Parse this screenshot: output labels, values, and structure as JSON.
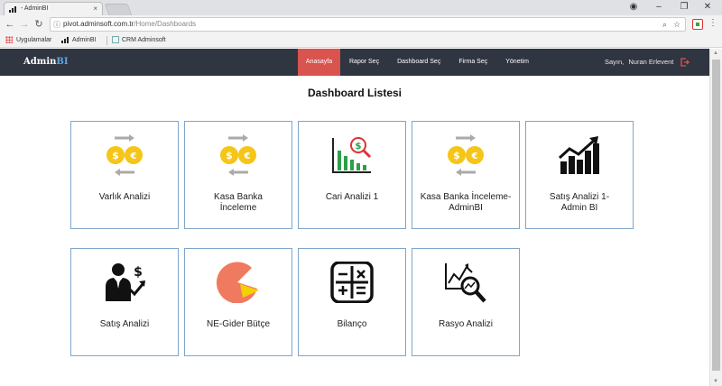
{
  "browser": {
    "tab_title": "- AdminBI",
    "url_host": "pivot.adminsoft.com.tr",
    "url_path": "/Home/Dashboards"
  },
  "bookmarks": [
    {
      "label": "Uygulamalar"
    },
    {
      "label": "AdminBI"
    },
    {
      "label": "CRM Adminsoft"
    }
  ],
  "app": {
    "brand_main": "Admin",
    "brand_accent": "BI",
    "nav": [
      {
        "label": "Anasayfa",
        "active": true
      },
      {
        "label": "Rapor Seç"
      },
      {
        "label": "Dashboard Seç"
      },
      {
        "label": "Firma Seç"
      },
      {
        "label": "Yönetim"
      }
    ],
    "user_greeting": "Sayın,",
    "user_name": "Nuran Erlevent"
  },
  "page": {
    "title": "Dashboard Listesi",
    "cards": [
      {
        "label": "Varlık Analizi",
        "icon": "currency-exchange-icon"
      },
      {
        "label": "Kasa Banka İnceleme",
        "icon": "currency-exchange-icon"
      },
      {
        "label": "Cari Analizi 1",
        "icon": "chart-magnifier-icon"
      },
      {
        "label": "Kasa Banka İnceleme-AdminBI",
        "icon": "currency-exchange-icon"
      },
      {
        "label": "Satış Analizi 1-Admin BI",
        "icon": "growth-bars-icon"
      },
      {
        "label": "Satış Analizi",
        "icon": "sales-person-icon"
      },
      {
        "label": "NE-Gider Bütçe",
        "icon": "pie-chart-icon"
      },
      {
        "label": "Bilanço",
        "icon": "calculator-icon"
      },
      {
        "label": "Rasyo Analizi",
        "icon": "trend-search-icon"
      }
    ]
  },
  "colors": {
    "navbar": "#2f3541",
    "active_nav": "#d9534f",
    "card_border": "#7fa6c9",
    "coin_yellow": "#f5c518"
  }
}
